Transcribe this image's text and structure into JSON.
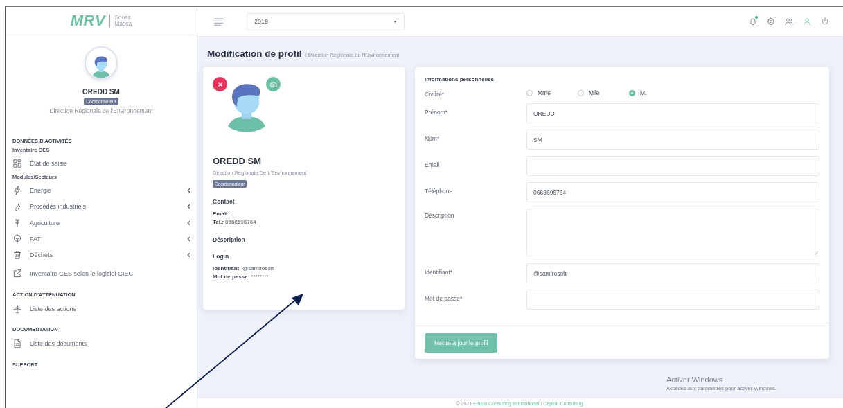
{
  "logo": {
    "brand": "MRV",
    "sub_lines": [
      "Souss",
      "Massa"
    ]
  },
  "sidebar": {
    "profile": {
      "name": "OREDD SM",
      "role": "Coordonnateur",
      "organization": "Direction Régionale de l'Environnement"
    },
    "sections": [
      {
        "title": "DONNÉES D'ACTIVITÉS",
        "groups": [
          {
            "title": "Inventaire GES",
            "items": [
              {
                "label": "État de saisie",
                "kind": "grid",
                "expandable": false
              }
            ]
          },
          {
            "title": "Modules/Secteurs",
            "items": [
              {
                "label": "Energie",
                "kind": "bolt",
                "expandable": true
              },
              {
                "label": "Procédés industriels",
                "kind": "wrench",
                "expandable": true
              },
              {
                "label": "Agriculture",
                "kind": "leaf",
                "expandable": true
              },
              {
                "label": "FAT",
                "kind": "tree",
                "expandable": true
              },
              {
                "label": "Déchets",
                "kind": "trash",
                "expandable": true
              }
            ]
          },
          {
            "items": [
              {
                "label": "Inventaire GES selon le logiciel GIEC",
                "kind": "external",
                "expandable": false
              }
            ]
          }
        ]
      },
      {
        "title": "ACTION D'ATTÉNUATION",
        "groups": [
          {
            "items": [
              {
                "label": "Liste des actions",
                "kind": "plane",
                "expandable": false
              }
            ]
          }
        ]
      },
      {
        "title": "DOCUMENTATION",
        "groups": [
          {
            "items": [
              {
                "label": "Liste des documents",
                "kind": "document",
                "expandable": false
              }
            ]
          }
        ]
      },
      {
        "title": "SUPPORT"
      }
    ]
  },
  "topbar": {
    "year_select": {
      "value": "2019"
    },
    "icons": [
      {
        "kind": "bell",
        "has_notification": true
      },
      {
        "kind": "gear",
        "has_notification": false
      },
      {
        "kind": "users",
        "has_notification": false
      },
      {
        "kind": "user",
        "has_notification": false
      },
      {
        "kind": "power",
        "has_notification": false
      }
    ]
  },
  "page": {
    "title": "Modification de profil",
    "breadcrumb": "/ Direction Régionale de l'Environnement"
  },
  "profile_card": {
    "name": "OREDD SM",
    "organization": "Direction Régionale De L'Environnement",
    "role": "Coordonnateur",
    "sections": [
      {
        "title": "Contact",
        "lines": [
          {
            "label": "Email:"
          },
          {
            "label": "Tel.:",
            "value": "0668696764"
          }
        ]
      },
      {
        "title": "Déscription"
      },
      {
        "title": "Login",
        "lines": [
          {
            "label": "Identifiant:",
            "value": "@samirosoft"
          },
          {
            "label": "Mot de passe:",
            "value": "********"
          }
        ]
      }
    ]
  },
  "form": {
    "title": "Informations personnelles",
    "fields": [
      {
        "label": "Civilité*",
        "kind": "radio",
        "options": [
          {
            "label": "Mme",
            "selected": false
          },
          {
            "label": "Mlle",
            "selected": false
          },
          {
            "label": "M.",
            "selected": true
          }
        ]
      },
      {
        "label": "Prénom*",
        "kind": "text",
        "value": "OREDD"
      },
      {
        "label": "Nom*",
        "kind": "text",
        "value": "SM"
      },
      {
        "label": "Email",
        "kind": "text"
      },
      {
        "label": "Téléphone",
        "kind": "text",
        "value": "0668696764"
      },
      {
        "label": "Déscription",
        "kind": "textarea"
      },
      {
        "label": "Identifiant*",
        "kind": "text",
        "value": "@samirosoft"
      },
      {
        "label": "Mot de passe*",
        "kind": "text"
      }
    ],
    "submit": "Mettre à jour le profil"
  },
  "os_notice": {
    "title": "Activer Windows",
    "text": "Accédez aux paramètres pour activer Windows."
  },
  "footer": {
    "prefix": "© 2021",
    "links": [
      "Enviro Consulting International",
      "Capion Consulting."
    ],
    "separator": "/"
  },
  "annotation": {
    "kind": "arrow"
  }
}
